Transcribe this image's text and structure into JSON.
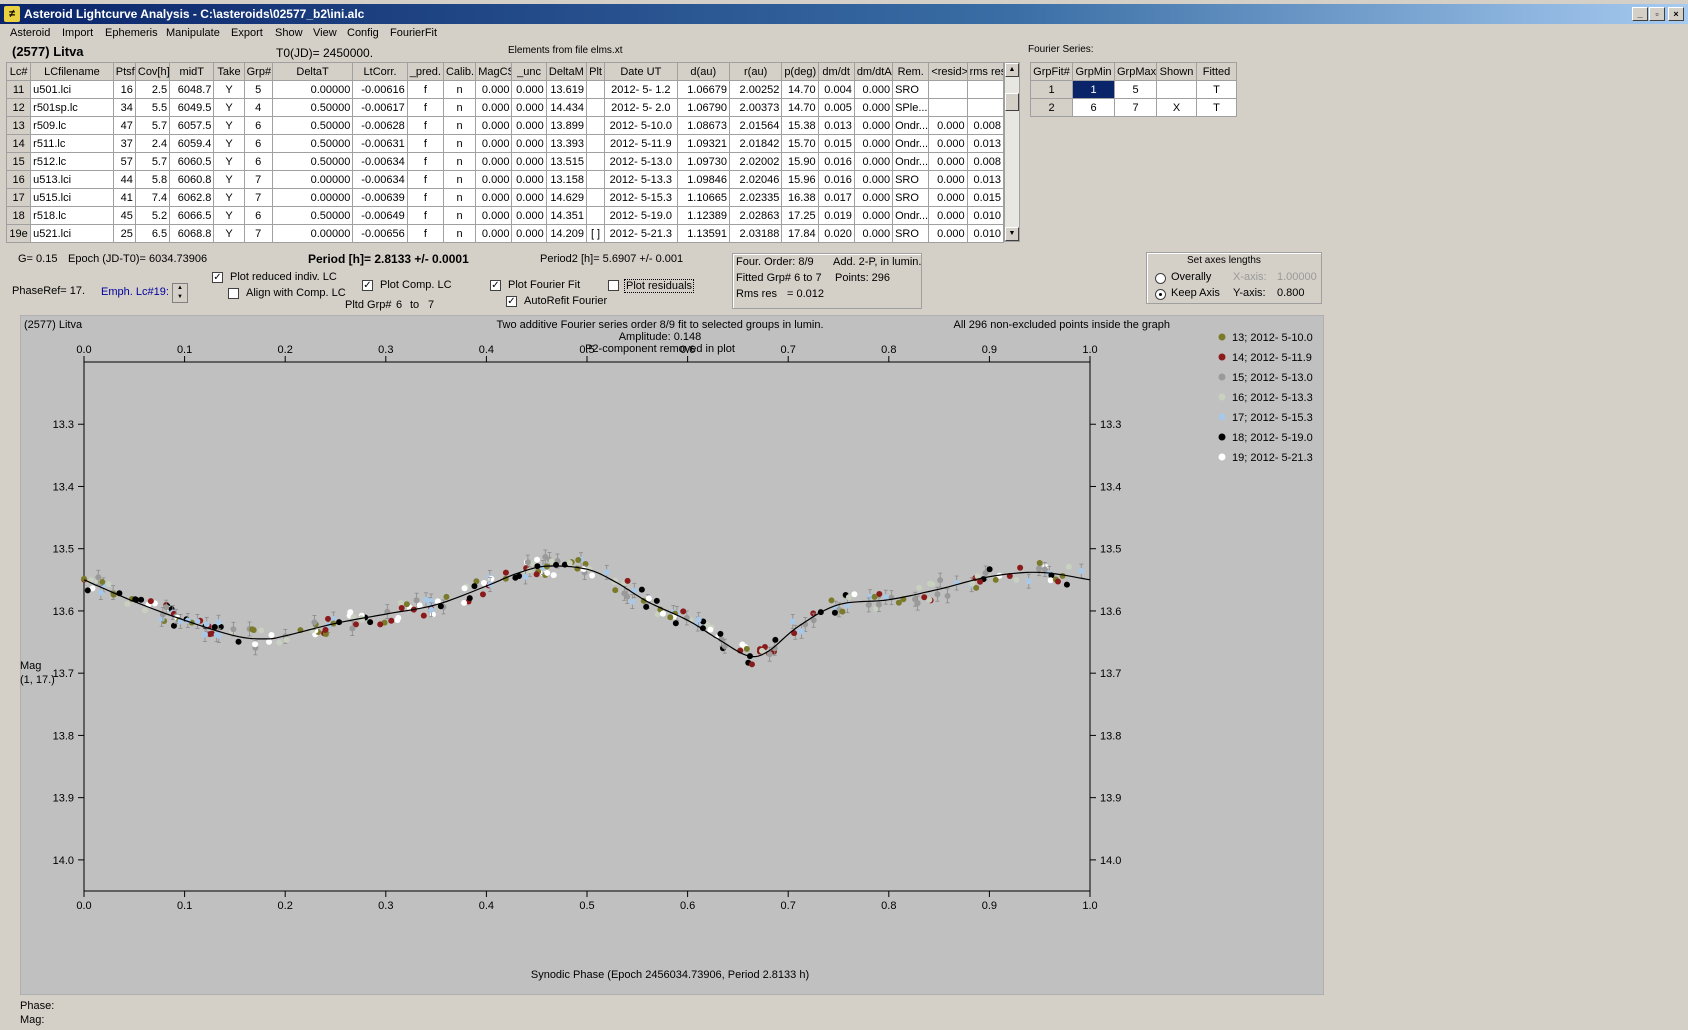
{
  "window": {
    "title": "Asteroid Lightcurve Analysis - C:\\asteroids\\02577_b2\\ini.alc",
    "min": "_",
    "max": "▫",
    "close": "×"
  },
  "menu": [
    "Asteroid",
    "Import",
    "Ephemeris",
    "Manipulate",
    "Export",
    "Show",
    "View",
    "Config",
    "FourierFit"
  ],
  "header": {
    "asteroid": "(2577) Litva",
    "t0": "T0(JD)= 2450000.",
    "elements": "Elements from file elms.xt"
  },
  "lc_table": {
    "columns": [
      "Lc#",
      "LCfilename",
      "Ptsf",
      "Cov[h]",
      "midT",
      "Take",
      "Grp#",
      "DeltaT",
      "LtCorr.",
      "_pred.",
      "Calib.",
      "MagCS",
      "_unc",
      "DeltaM",
      "Plt",
      "Date UT",
      "d(au)",
      "r(au)",
      "p(deg)",
      "dm/dt",
      "dm/dtA",
      "Rem.",
      "<resid>",
      "rms res"
    ],
    "rows": [
      [
        "11",
        "u501.lci",
        "16",
        "2.5",
        "6048.7",
        "Y",
        "5",
        "0.00000",
        "-0.00616",
        "f",
        "n",
        "0.000",
        "0.000",
        "13.619",
        "",
        "2012- 5- 1.2",
        "1.06679",
        "2.00252",
        "14.70",
        "0.004",
        "0.000",
        "SRO",
        "",
        ""
      ],
      [
        "12",
        "r501sp.lc",
        "34",
        "5.5",
        "6049.5",
        "Y",
        "4",
        "0.50000",
        "-0.00617",
        "f",
        "n",
        "0.000",
        "0.000",
        "14.434",
        "",
        "2012- 5- 2.0",
        "1.06790",
        "2.00373",
        "14.70",
        "0.005",
        "0.000",
        "SPle...",
        "",
        ""
      ],
      [
        "13",
        "r509.lc",
        "47",
        "5.7",
        "6057.5",
        "Y",
        "6",
        "0.50000",
        "-0.00628",
        "f",
        "n",
        "0.000",
        "0.000",
        "13.899",
        "",
        "2012- 5-10.0",
        "1.08673",
        "2.01564",
        "15.38",
        "0.013",
        "0.000",
        "Ondr...",
        "0.000",
        "0.008"
      ],
      [
        "14",
        "r511.lc",
        "37",
        "2.4",
        "6059.4",
        "Y",
        "6",
        "0.50000",
        "-0.00631",
        "f",
        "n",
        "0.000",
        "0.000",
        "13.393",
        "",
        "2012- 5-11.9",
        "1.09321",
        "2.01842",
        "15.70",
        "0.015",
        "0.000",
        "Ondr...",
        "0.000",
        "0.013"
      ],
      [
        "15",
        "r512.lc",
        "57",
        "5.7",
        "6060.5",
        "Y",
        "6",
        "0.50000",
        "-0.00634",
        "f",
        "n",
        "0.000",
        "0.000",
        "13.515",
        "",
        "2012- 5-13.0",
        "1.09730",
        "2.02002",
        "15.90",
        "0.016",
        "0.000",
        "Ondr...",
        "0.000",
        "0.008"
      ],
      [
        "16",
        "u513.lci",
        "44",
        "5.8",
        "6060.8",
        "Y",
        "7",
        "0.00000",
        "-0.00634",
        "f",
        "n",
        "0.000",
        "0.000",
        "13.158",
        "",
        "2012- 5-13.3",
        "1.09846",
        "2.02046",
        "15.96",
        "0.016",
        "0.000",
        "SRO",
        "0.000",
        "0.013"
      ],
      [
        "17",
        "u515.lci",
        "41",
        "7.4",
        "6062.8",
        "Y",
        "7",
        "0.00000",
        "-0.00639",
        "f",
        "n",
        "0.000",
        "0.000",
        "14.629",
        "",
        "2012- 5-15.3",
        "1.10665",
        "2.02335",
        "16.38",
        "0.017",
        "0.000",
        "SRO",
        "0.000",
        "0.015"
      ],
      [
        "18",
        "r518.lc",
        "45",
        "5.2",
        "6066.5",
        "Y",
        "6",
        "0.50000",
        "-0.00649",
        "f",
        "n",
        "0.000",
        "0.000",
        "14.351",
        "",
        "2012- 5-19.0",
        "1.12389",
        "2.02863",
        "17.25",
        "0.019",
        "0.000",
        "Ondr...",
        "0.000",
        "0.010"
      ],
      [
        "19e",
        "u521.lci",
        "25",
        "6.5",
        "6068.8",
        "Y",
        "7",
        "0.00000",
        "-0.00656",
        "f",
        "n",
        "0.000",
        "0.000",
        "14.209",
        "[ ]",
        "2012- 5-21.3",
        "1.13591",
        "2.03188",
        "17.84",
        "0.020",
        "0.000",
        "SRO",
        "0.000",
        "0.010"
      ]
    ]
  },
  "fourier_series": {
    "label": "Fourier Series:",
    "columns": [
      "GrpFit#",
      "GrpMin",
      "GrpMax",
      "Shown",
      "Fitted"
    ],
    "rows": [
      [
        "1",
        "1",
        "5",
        "",
        "T"
      ],
      [
        "2",
        "6",
        "7",
        "X",
        "T"
      ]
    ]
  },
  "info": {
    "g": "G= 0.15",
    "epoch": "Epoch (JD-T0)= 6034.73906",
    "period": "Period [h]= 2.8133 +/- 0.0001",
    "period2": "Period2 [h]= 5.6907 +/- 0.001",
    "phaseref": "PhaseRef= 17.",
    "emph": "Emph. Lc#19:",
    "pltd_grp": "Pltd Grp#",
    "grp_from": "6",
    "to": "to",
    "grp_to": "7"
  },
  "checkboxes": {
    "plot_reduced": {
      "label": "Plot reduced indiv. LC",
      "checked": "✓"
    },
    "align_comp": {
      "label": "Align with Comp. LC",
      "checked": ""
    },
    "plot_comp": {
      "label": "Plot Comp. LC",
      "checked": "✓"
    },
    "plot_fourier": {
      "label": "Plot Fourier Fit",
      "checked": "✓"
    },
    "autorefit": {
      "label": "AutoRefit Fourier",
      "checked": "✓"
    },
    "plot_residuals": {
      "label": "Plot residuals",
      "checked": ""
    }
  },
  "fit_info": {
    "order": "Four. Order: 8/9",
    "add": "Add. 2-P, in lumin.",
    "fitted": "Fitted Grp# 6 to 7",
    "points": "Points: 296",
    "rms_label": "Rms res",
    "rms_val": "= 0.012"
  },
  "axes_box": {
    "title": "Set axes lengths",
    "overally": "Overally",
    "keep": "Keep Axis",
    "xaxis_label": "X-axis:",
    "xaxis_val": "1.00000",
    "yaxis_label": "Y-axis:",
    "yaxis_val": "0.800"
  },
  "chart_data": {
    "type": "scatter",
    "title": "Two additive Fourier series order 8/9 fit to selected groups in lumin.",
    "subtitle": "Amplitude: 0.148",
    "subtitle2": "P2-component removed in plot",
    "object": "(2577) Litva",
    "note": "All 296 non-excluded points inside the graph",
    "xlabel": "Synodic Phase (Epoch 2456034.73906, Period 2.8133 h)",
    "ylabel": "Mag",
    "ylabel2": "(1, 17.)",
    "xlim": [
      0,
      1
    ],
    "ylim": [
      13.2,
      14.05
    ],
    "y_inverted": true,
    "xticks": [
      "0.0",
      "0.1",
      "0.2",
      "0.3",
      "0.4",
      "0.5",
      "0.6",
      "0.7",
      "0.8",
      "0.9",
      "1.0"
    ],
    "yticks": [
      "13.3",
      "13.4",
      "13.5",
      "13.6",
      "13.7",
      "13.8",
      "13.9",
      "14.0"
    ],
    "series": [
      {
        "name": "13; 2012- 5-10.0",
        "color": "#7a7a2a"
      },
      {
        "name": "14; 2012- 5-11.9",
        "color": "#8b1a1a"
      },
      {
        "name": "15; 2012- 5-13.0",
        "color": "#9a9a9a"
      },
      {
        "name": "16; 2012- 5-13.3",
        "color": "#c8d0c0"
      },
      {
        "name": "17; 2012- 5-15.3",
        "color": "#a8c8e8"
      },
      {
        "name": "18; 2012- 5-19.0",
        "color": "#000000"
      },
      {
        "name": "19; 2012- 5-21.3",
        "color": "#ffffff"
      }
    ],
    "fit_curve": {
      "x": [
        0,
        0.05,
        0.1,
        0.15,
        0.18,
        0.2,
        0.25,
        0.3,
        0.35,
        0.4,
        0.43,
        0.46,
        0.5,
        0.53,
        0.56,
        0.6,
        0.63,
        0.66,
        0.68,
        0.71,
        0.75,
        0.8,
        0.85,
        0.9,
        0.95,
        1.0
      ],
      "y": [
        13.55,
        13.585,
        13.615,
        13.64,
        13.645,
        13.64,
        13.62,
        13.605,
        13.59,
        13.56,
        13.54,
        13.528,
        13.533,
        13.555,
        13.585,
        13.615,
        13.645,
        13.672,
        13.665,
        13.625,
        13.59,
        13.582,
        13.565,
        13.545,
        13.538,
        13.55
      ]
    }
  },
  "status": {
    "phase": "Phase:",
    "mag": "Mag:"
  }
}
